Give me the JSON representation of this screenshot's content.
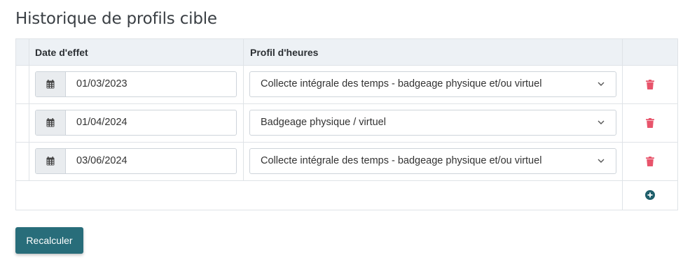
{
  "section_title": "Historique de profils cible",
  "table": {
    "headers": {
      "date": "Date d'effet",
      "profile": "Profil d'heures"
    },
    "rows": [
      {
        "date": "01/03/2023",
        "profile": "Collecte intégrale des temps - badgeage physique et/ou virtuel"
      },
      {
        "date": "01/04/2024",
        "profile": "Badgeage physique / virtuel"
      },
      {
        "date": "03/06/2024",
        "profile": "Collecte intégrale des temps - badgeage physique et/ou virtuel"
      }
    ]
  },
  "icons": {
    "calendar": "calendar-icon",
    "chevron": "chevron-down-icon",
    "delete": "trash-icon",
    "add": "plus-circle-icon"
  },
  "actions": {
    "recalculate_label": "Recalculer"
  },
  "colors": {
    "primary": "#286d7a",
    "delete": "#e8546b",
    "add": "#1f5f6b",
    "header_bg": "#edf1f5"
  }
}
